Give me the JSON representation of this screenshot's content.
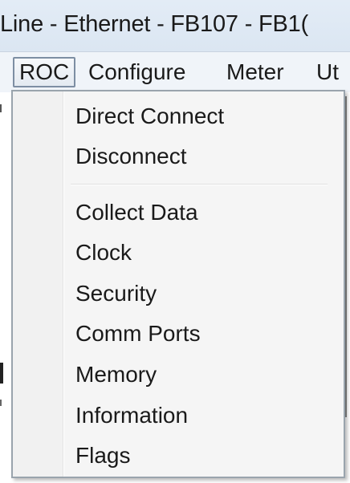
{
  "window": {
    "title": "Line - Ethernet - FB107 - FB1("
  },
  "menubar": {
    "items": [
      {
        "label": "ROC"
      },
      {
        "label": "Configure"
      },
      {
        "label": "Meter"
      },
      {
        "label": "Ut"
      }
    ],
    "active_index": 0
  },
  "roc_menu": {
    "items": [
      {
        "label": "Direct Connect"
      },
      {
        "label": "Disconnect"
      },
      {
        "label": "Collect Data"
      },
      {
        "label": "Clock"
      },
      {
        "label": "Security"
      },
      {
        "label": "Comm Ports"
      },
      {
        "label": "Memory"
      },
      {
        "label": "Information"
      },
      {
        "label": "Flags"
      }
    ]
  },
  "colors": {
    "menu_background": "#f5f5f5",
    "active_menu_border": "#7d8ea3",
    "titlebar": "#dbe6f2"
  }
}
